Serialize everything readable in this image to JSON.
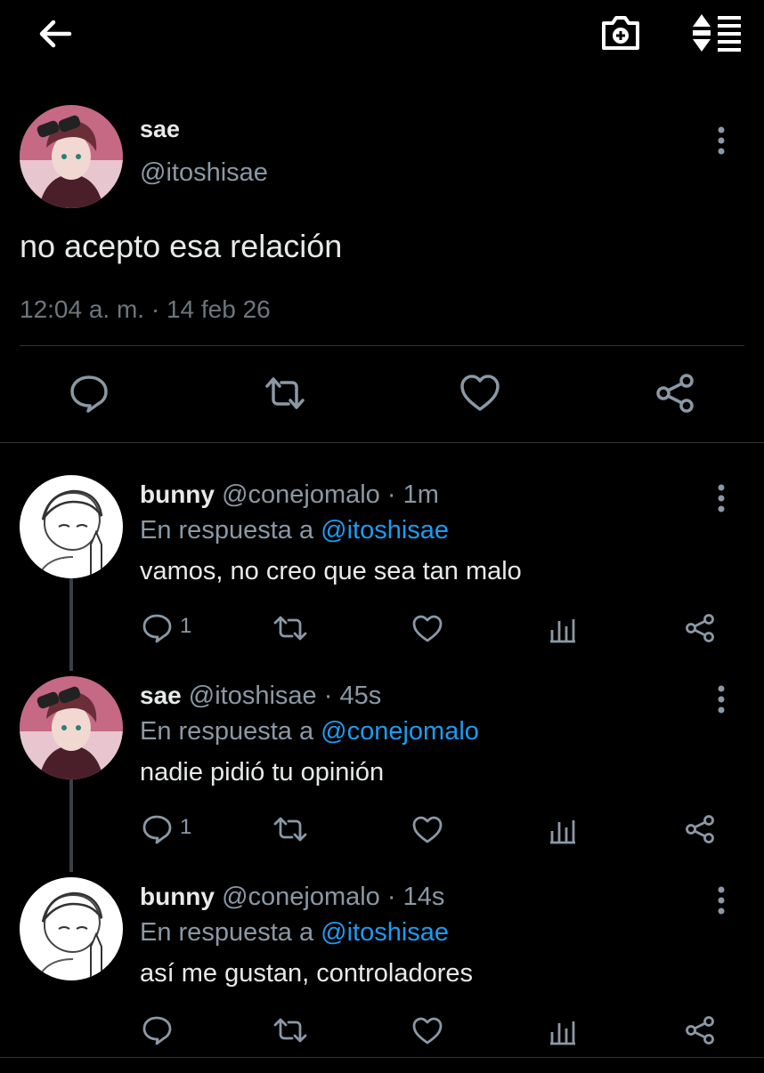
{
  "icons": {
    "back": "arrow-left-icon",
    "camera": "camera-plus-icon",
    "sort": "sort-list-icon"
  },
  "colors": {
    "background": "#000000",
    "text": "#e7e9ea",
    "muted": "#8b98a5",
    "accent": "#1d9bf0"
  },
  "tweet": {
    "name": "sae",
    "handle": "@itoshisae",
    "text": "no acepto esa relación",
    "timestamp": "12:04 a. m. · 14 feb 26"
  },
  "replies": [
    {
      "name": "bunny",
      "meta": "@conejomalo · 1m",
      "in_reply_label": "En respuesta a",
      "mention": "@itoshisae",
      "text": "vamos, no creo que sea tan malo",
      "reply_count": "1"
    },
    {
      "name": "sae",
      "meta": "@itoshisae · 45s",
      "in_reply_label": "En respuesta a",
      "mention": "@conejomalo",
      "text": "nadie pidió tu opinión",
      "reply_count": "1"
    },
    {
      "name": "bunny",
      "meta": "@conejomalo · 14s",
      "in_reply_label": "En respuesta a",
      "mention": "@itoshisae",
      "text": "así me gustan, controladores",
      "reply_count": ""
    }
  ]
}
